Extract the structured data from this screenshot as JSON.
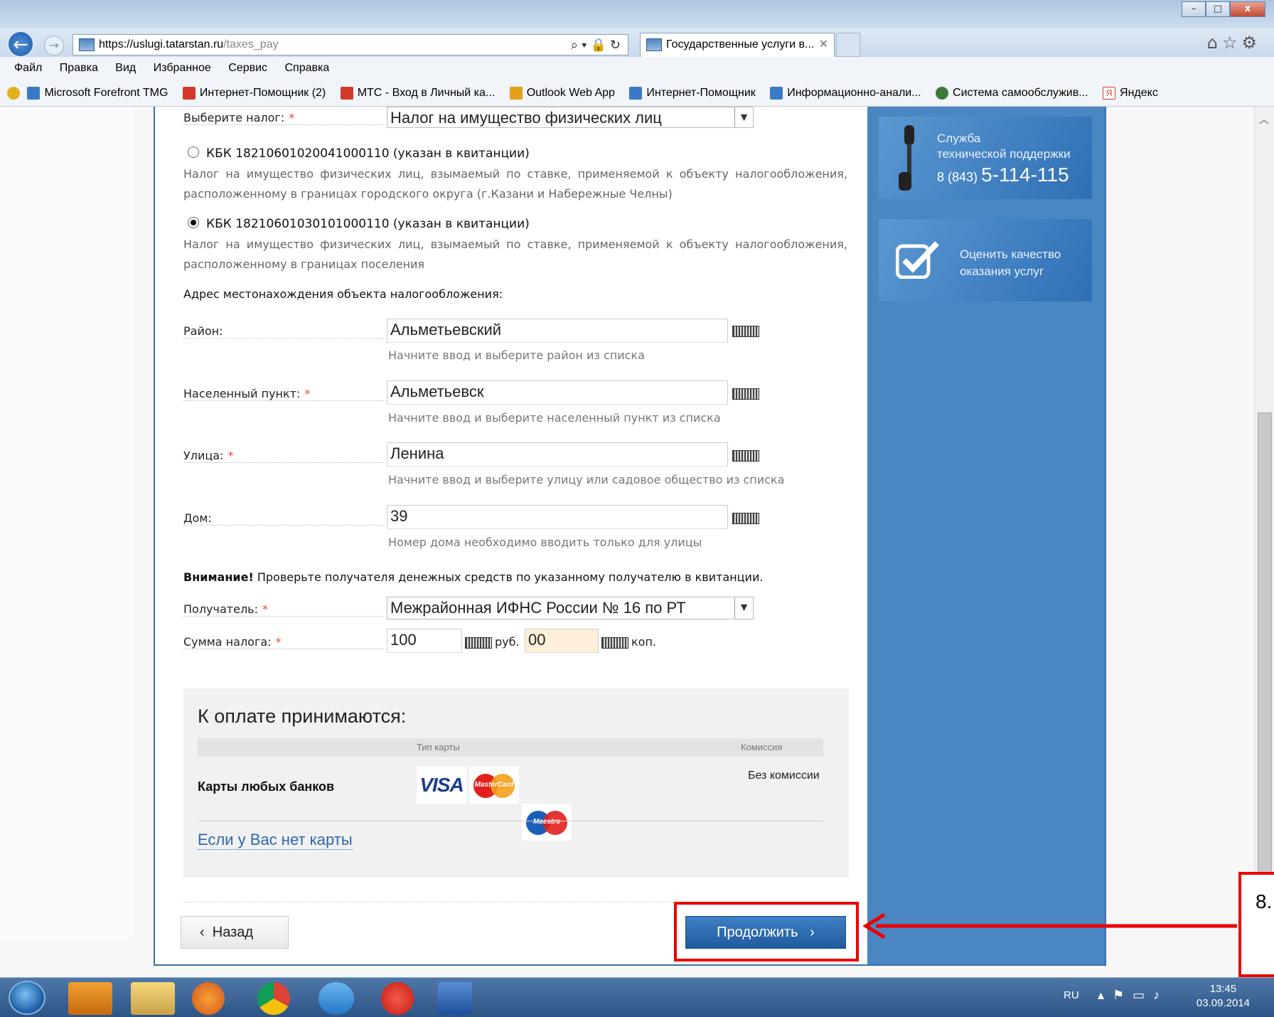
{
  "browser": {
    "address_host": "https://uslugi.tatarstan.ru",
    "address_path": "/taxes_pay",
    "tab_title": "Государственные услуги в...",
    "window_buttons": [
      "–",
      "□",
      "x"
    ]
  },
  "menu": [
    "Файл",
    "Правка",
    "Вид",
    "Избранное",
    "Сервис",
    "Справка"
  ],
  "favorites": [
    {
      "label": "Microsoft Forefront TMG",
      "icon": "ie-icon"
    },
    {
      "label": "Интернет-Помощник (2)",
      "icon": "red-icon"
    },
    {
      "label": "МТС - Вход в Личный ка...",
      "icon": "red-icon"
    },
    {
      "label": "Outlook Web App",
      "icon": "outlook-icon"
    },
    {
      "label": "Интернет-Помощник",
      "icon": "ie-icon"
    },
    {
      "label": "Информационно-анали...",
      "icon": "ie-icon"
    },
    {
      "label": "Система самообслужив...",
      "icon": "globe-icon"
    },
    {
      "label": "Яндекс",
      "icon": "yandex-icon"
    }
  ],
  "form": {
    "tax_label": "Выберите налог:",
    "tax_value": "Налог на имущество физических лиц",
    "kbk1_title": "КБК 18210601020041000110 (указан в квитанции)",
    "kbk1_desc": "Налог на имущество физических лиц, взымаемый по ставке, применяемой к объекту налогообложения, расположенному в границах городского округа (г.Казани и Набережные Челны)",
    "kbk2_title": "КБК 18210601030101000110 (указан в квитанции)",
    "kbk2_desc": "Налог на имущество физических лиц, взымаемый по ставке, применяемой к объекту налогообложения, расположенному в границах поселения",
    "address_heading": "Адрес местонахождения объекта налогообложения:",
    "district_label": "Район:",
    "district_value": "Альметьевский",
    "district_hint": "Начните ввод и выберите район из списка",
    "locality_label": "Населенный пункт:",
    "locality_value": "Альметьевск",
    "locality_hint": "Начните ввод и выберите населенный пункт из списка",
    "street_label": "Улица:",
    "street_value": "Ленина",
    "street_hint": "Начните ввод и выберите улицу или садовое общество из списка",
    "house_label": "Дом:",
    "house_value": "39",
    "house_hint": "Номер дома необходимо вводить только для улицы",
    "warning_bold": "Внимание!",
    "warning_text": " Проверьте получателя денежных средств по указанному получателю в квитанции.",
    "recipient_label": "Получатель:",
    "recipient_value": "Межрайонная ИФНС России № 16 по РТ",
    "sum_label": "Сумма налога:",
    "sum_rub": "100",
    "rub_unit": "руб.",
    "sum_kop": "00",
    "kop_unit": "коп."
  },
  "payment": {
    "heading": "К оплате принимаются:",
    "col_card_type": "Тип карты",
    "col_commission": "Комиссия",
    "row_label": "Карты любых банков",
    "row_commission": "Без комиссии",
    "visa_label": "VISA",
    "mastercard_label": "MasterCard",
    "maestro_label": "Maestro",
    "no_card_link": "Если у Вас нет карты"
  },
  "buttons": {
    "back": "Назад",
    "continue": "Продолжить"
  },
  "sidebar": {
    "support_line1": "Служба",
    "support_line2": "технической поддержки",
    "support_code": "8 (843)",
    "support_number": "5-114-115",
    "rate_line1": "Оценить качество",
    "rate_line2": "оказания услуг"
  },
  "annotation": {
    "step": "8."
  },
  "taskbar": {
    "lang": "RU",
    "time": "13:45",
    "date": "03.09.2014"
  }
}
